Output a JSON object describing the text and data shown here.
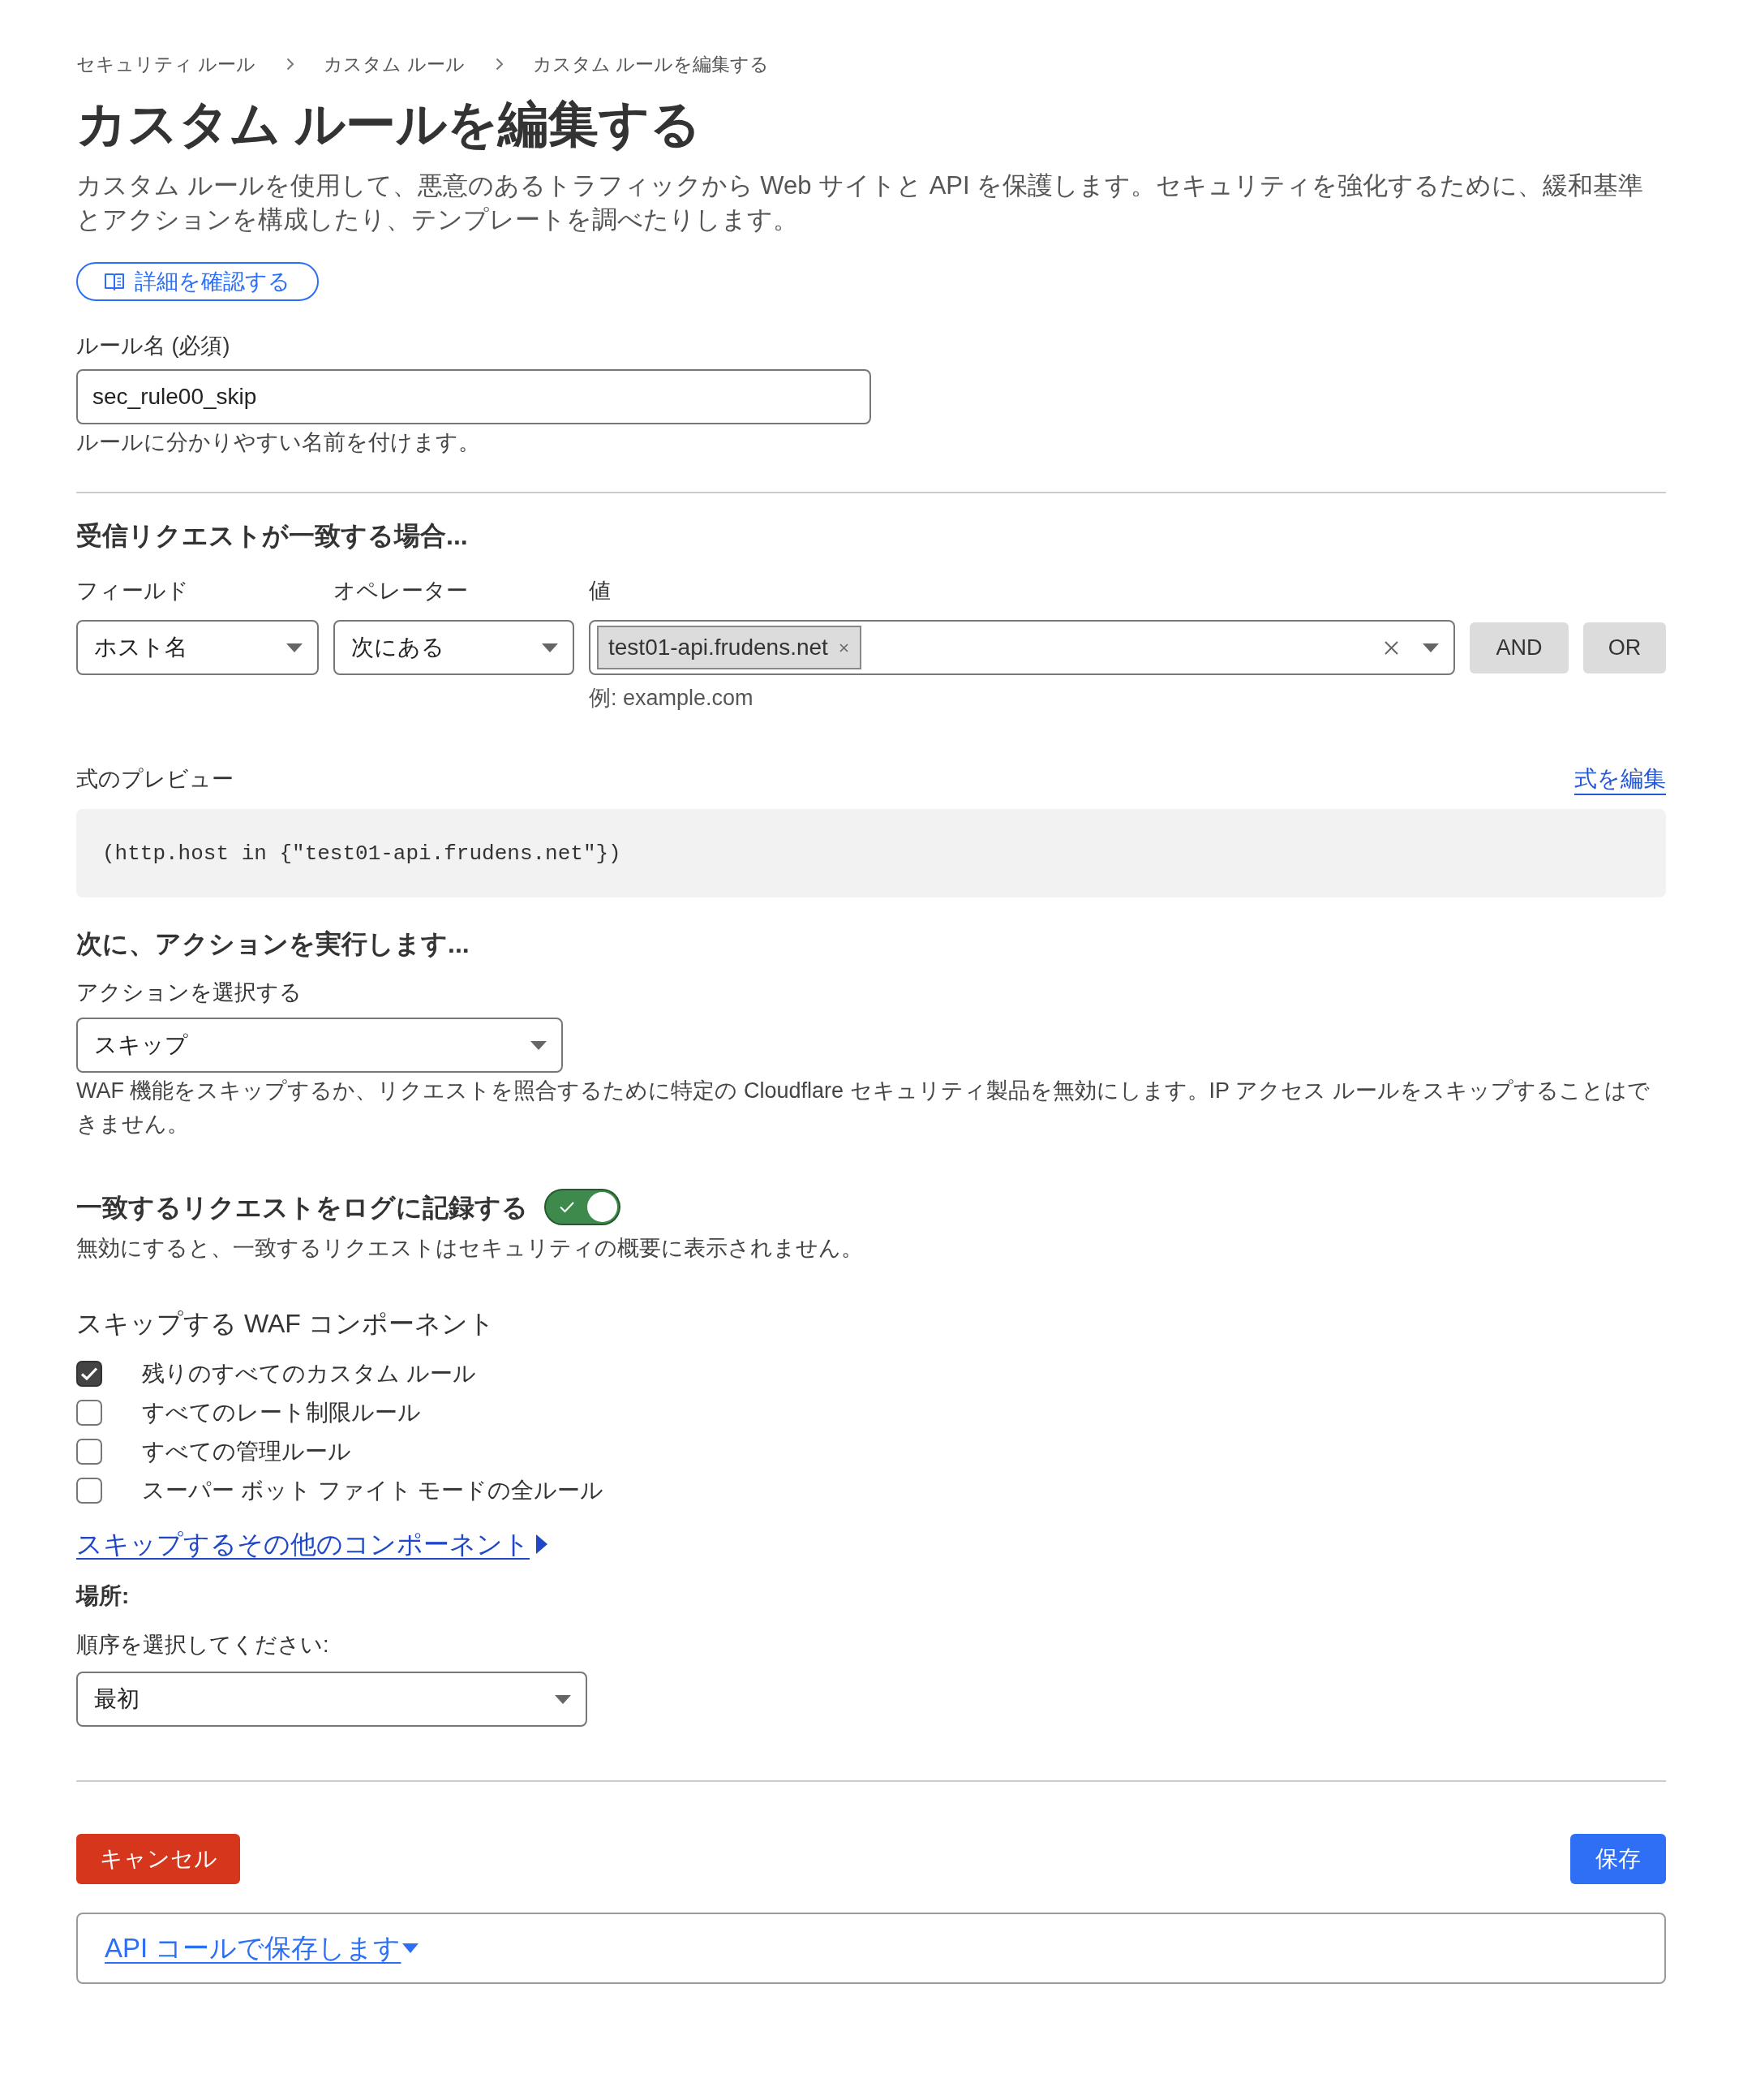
{
  "breadcrumb": [
    {
      "label": "セキュリティ ルール"
    },
    {
      "label": "カスタム ルール"
    },
    {
      "label": "カスタム ルールを編集する"
    }
  ],
  "title": "カスタム ルールを編集する",
  "description": "カスタム ルールを使用して、悪意のあるトラフィックから Web サイトと API を保護します。セキュリティを強化するために、緩和基準とアクションを構成したり、テンプレートを調べたりします。",
  "learn_more_button": "詳細を確認する",
  "rule_name": {
    "label": "ルール名 (必須)",
    "value": "sec_rule00_skip",
    "help": "ルールに分かりやすい名前を付けます。"
  },
  "conditions": {
    "heading": "受信リクエストが一致する場合...",
    "field": {
      "label": "フィールド",
      "value": "ホスト名"
    },
    "operator": {
      "label": "オペレーター",
      "value": "次にある"
    },
    "value": {
      "label": "値",
      "tags": [
        "test01-api.frudens.net"
      ],
      "hint": "例: example.com"
    },
    "logic_buttons": [
      "AND",
      "OR"
    ]
  },
  "expression_preview": {
    "label": "式のプレビュー",
    "edit_link": "式を編集",
    "code": "(http.host in {\"test01-api.frudens.net\"})"
  },
  "action": {
    "heading": "次に、アクションを実行します...",
    "label": "アクションを選択する",
    "value": "スキップ",
    "help": "WAF 機能をスキップするか、リクエストを照合するために特定の Cloudflare セキュリティ製品を無効にします。IP アクセス ルールをスキップすることはできません。"
  },
  "logging": {
    "label": "一致するリクエストをログに記録する",
    "on": true,
    "help": "無効にすると、一致するリクエストはセキュリティの概要に表示されません。"
  },
  "skip_components": {
    "heading": "スキップする WAF コンポーネント",
    "items": [
      {
        "label": "残りのすべてのカスタム ルール",
        "checked": true
      },
      {
        "label": "すべてのレート制限ルール",
        "checked": false
      },
      {
        "label": "すべての管理ルール",
        "checked": false
      },
      {
        "label": "スーパー ボット ファイト モードの全ルール",
        "checked": false
      }
    ],
    "more_link": "スキップするその他のコンポーネント"
  },
  "placement": {
    "heading": "場所:",
    "label": "順序を選択してください:",
    "value": "最初"
  },
  "footer": {
    "cancel_button": "キャンセル",
    "save_button": "保存",
    "api_link": "API コールで保存します"
  }
}
